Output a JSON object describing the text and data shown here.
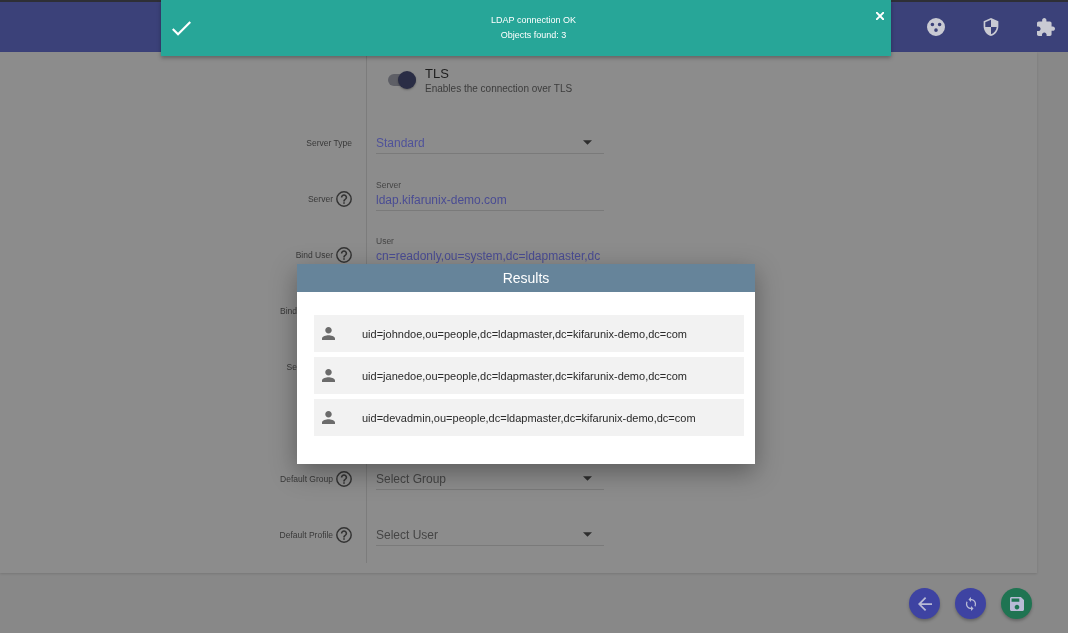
{
  "toast": {
    "lines": [
      "LDAP connection OK",
      "Objects found: 3"
    ]
  },
  "form": {
    "rows": [
      {
        "kind": "toggle",
        "title": "TLS",
        "description": "Enables the connection over TLS",
        "on": true
      },
      {
        "kind": "select",
        "label": "Server Type",
        "help": false,
        "value": "Standard"
      },
      {
        "kind": "text",
        "label": "Server",
        "help": true,
        "field_label": "Server",
        "value": "ldap.kifarunix-demo.com"
      },
      {
        "kind": "text",
        "label": "Bind User",
        "help": true,
        "field_label": "User",
        "value": "cn=readonly,ou=system,dc=ldapmaster,dc"
      },
      {
        "kind": "covered",
        "label": "Bind"
      },
      {
        "kind": "covered",
        "label": "Se"
      },
      {
        "kind": "select",
        "label": "Default Group",
        "help": true,
        "placeholder": "Select Group"
      },
      {
        "kind": "select",
        "label": "Default Profile",
        "help": true,
        "placeholder": "Select User"
      }
    ]
  },
  "results_dialog": {
    "title": "Results",
    "items": [
      "uid=johndoe,ou=people,dc=ldapmaster,dc=kifarunix-demo,dc=com",
      "uid=janedoe,ou=people,dc=ldapmaster,dc=kifarunix-demo,dc=com",
      "uid=devadmin,ou=people,dc=ldapmaster,dc=kifarunix-demo,dc=com"
    ]
  }
}
